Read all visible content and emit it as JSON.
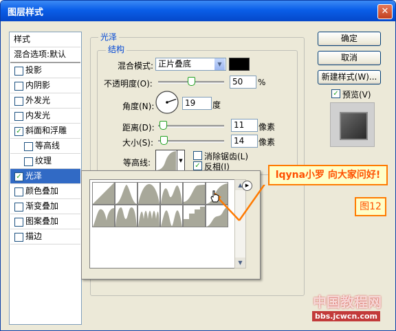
{
  "window": {
    "title": "图层样式",
    "close_label": "✕"
  },
  "style_list": {
    "header": "样式",
    "blend_options": "混合选项:默认",
    "items": [
      {
        "label": "投影",
        "checked": false,
        "indent": false,
        "selected": false
      },
      {
        "label": "内阴影",
        "checked": false,
        "indent": false,
        "selected": false
      },
      {
        "label": "外发光",
        "checked": false,
        "indent": false,
        "selected": false
      },
      {
        "label": "内发光",
        "checked": false,
        "indent": false,
        "selected": false
      },
      {
        "label": "斜面和浮雕",
        "checked": true,
        "indent": false,
        "selected": false
      },
      {
        "label": "等高线",
        "checked": false,
        "indent": true,
        "selected": false
      },
      {
        "label": "纹理",
        "checked": false,
        "indent": true,
        "selected": false
      },
      {
        "label": "光泽",
        "checked": true,
        "indent": false,
        "selected": true
      },
      {
        "label": "颜色叠加",
        "checked": false,
        "indent": false,
        "selected": false
      },
      {
        "label": "渐变叠加",
        "checked": false,
        "indent": false,
        "selected": false
      },
      {
        "label": "图案叠加",
        "checked": false,
        "indent": false,
        "selected": false
      },
      {
        "label": "描边",
        "checked": false,
        "indent": false,
        "selected": false
      }
    ]
  },
  "buttons": {
    "ok": "确定",
    "cancel": "取消",
    "new_style": "新建样式(W)...",
    "preview": "预览(V)",
    "preview_checked": true
  },
  "satin": {
    "group_title": "光泽",
    "structure_title": "结构",
    "blend_mode_label": "混合模式:",
    "blend_mode_value": "正片叠底",
    "blend_color": "#000000",
    "opacity_label": "不透明度(O):",
    "opacity_value": "50",
    "opacity_unit": "%",
    "opacity_fraction": 0.5,
    "angle_label": "角度(N):",
    "angle_value": "19",
    "angle_unit": "度",
    "distance_label": "距离(D):",
    "distance_value": "11",
    "distance_unit": "像素",
    "size_label": "大小(S):",
    "size_value": "14",
    "size_unit": "像素",
    "contour_label": "等高线:",
    "anti_alias_label": "消除锯齿(L)",
    "anti_alias_checked": false,
    "invert_label": "反相(I)",
    "invert_checked": true
  },
  "contour_popup": {
    "arrow": "▶",
    "scroll_up": "▲",
    "scroll_down": "▼"
  },
  "annotations": {
    "banner": "lqyna小罗 向大家问好!",
    "figure": "图12"
  },
  "watermark": {
    "line1": "中国教程网",
    "line2": "bbs.jcwcn.com"
  },
  "colors": {
    "accent_orange": "#ff7a00",
    "selection_blue": "#316ac5",
    "title_blue": "#0a5ee8"
  }
}
